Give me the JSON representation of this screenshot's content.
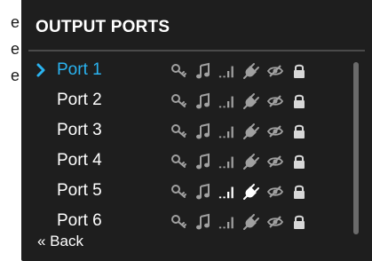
{
  "edge_text": [
    "e",
    "e",
    "e"
  ],
  "panel": {
    "title": "OUTPUT PORTS",
    "back_label": "« Back"
  },
  "ports": [
    {
      "label": "Port 1",
      "selected": true,
      "highlight": false
    },
    {
      "label": "Port 2",
      "selected": false,
      "highlight": false
    },
    {
      "label": "Port 3",
      "selected": false,
      "highlight": false
    },
    {
      "label": "Port 4",
      "selected": false,
      "highlight": false
    },
    {
      "label": "Port 5",
      "selected": false,
      "highlight": true
    },
    {
      "label": "Port 6",
      "selected": false,
      "highlight": false
    }
  ],
  "port_icons": [
    "key-icon",
    "music-note-icon",
    "signal-bars-icon",
    "plug-icon",
    "hidden-eye-icon",
    "lock-icon"
  ],
  "colors": {
    "background": "#1e1e1e",
    "text": "#ffffff",
    "accent": "#2ab3f0",
    "icon_dim": "#a0a0a0",
    "icon_bright": "#ffffff"
  }
}
